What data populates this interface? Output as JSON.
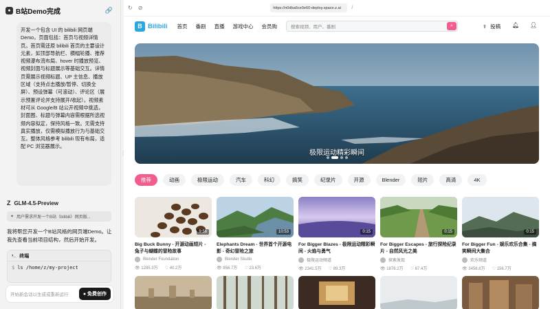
{
  "app": {
    "title": "B站Demo完成",
    "logo_icon": "bear-icon",
    "share_icon": "link-icon"
  },
  "chat": {
    "user_message": "开发一个包含 UI 的 bilibili 网页端Demo，页面包括：首页与视频详情页。首页需还原 bilibili 首页的主要设计元素，如顶部导航栏、横幅轮播、推荐视频瀑布流布局、hover 时播放预览、视频封面与标题展示等基础交互。详情页需展示视频标题、UP 主信息、播放区域（支持点击播放/暂停、切换全屏）、预设弹幕（可滚动）、评论区（展示预置评论并支持展开/收起）。视频素材可从 Google/B 站公开视频中挑选，封面图、标题与弹幕内容需根据所选视频内容拟定，保持风格一致。无需支持真实播放，仅需模拟播放行为与基础交互。整体风格参考 bilibili 现有布局，适配 PC 浏览器展示。",
    "model_name": "GLM-4.5-Preview",
    "tool_text": "用户需求开发一个B站（bilibili）网页版...",
    "assistant_text": "我将帮您开发一个B站风格的网页端Demo。让我先查看当前项目结构，然后开始开发。",
    "terminal": {
      "title": "终端",
      "prompt": "$",
      "command": "ls /home/z/my-project"
    },
    "input_placeholder": "开始新会话以生成或重新运行",
    "create_button": "免费创作"
  },
  "browser": {
    "url": "https://n0dba6ce0e60-deploy.space.z.ai",
    "url_suffix": "/"
  },
  "site": {
    "brand": "Bilibili",
    "nav": [
      "首页",
      "番剧",
      "直播",
      "游戏中心",
      "会员购"
    ],
    "search_placeholder": "搜索视频、用户、番剧",
    "upload_label": "投稿",
    "hero_caption": "极限运动精彩瞬间",
    "tags": [
      "推荐",
      "动画",
      "极限运动",
      "汽车",
      "科幻",
      "搞笑",
      "纪录片",
      "开源",
      "Blender",
      "短片",
      "高清",
      "4K"
    ],
    "videos": [
      {
        "title": "Big Buck Bunny - 开源动画短片 - 兔子与蝴蝶的冒险故事",
        "uploader": "Blender Foundation",
        "views": "1285.3万",
        "likes": "40.2万",
        "duration": "9:56"
      },
      {
        "title": "Elephants Dream - 世界首个开源电影 - 奇幻冒险之旅",
        "uploader": "Blender Studio",
        "views": "856.7万",
        "likes": "23.6万",
        "duration": "10:53"
      },
      {
        "title": "For Bigger Blazes - 极限运动精彩瞬间 - 火焰与勇气",
        "uploader": "极限运动频道",
        "views": "2341.5万",
        "likes": "89.3万",
        "duration": "0:15"
      },
      {
        "title": "For Bigger Escapes - 旅行探险纪录片 - 自然风光之美",
        "uploader": "探索发现",
        "views": "1876.2万",
        "likes": "67.4万",
        "duration": "0:15"
      },
      {
        "title": "For Bigger Fun - 娱乐欢乐合集 - 搞笑瞬间大集合",
        "uploader": "欢乐频道",
        "views": "3456.8万",
        "likes": "156.7万",
        "duration": "0:15"
      }
    ]
  },
  "colors": {
    "brand_blue": "#2aa7e0",
    "accent_pink": "#f25d8e"
  }
}
